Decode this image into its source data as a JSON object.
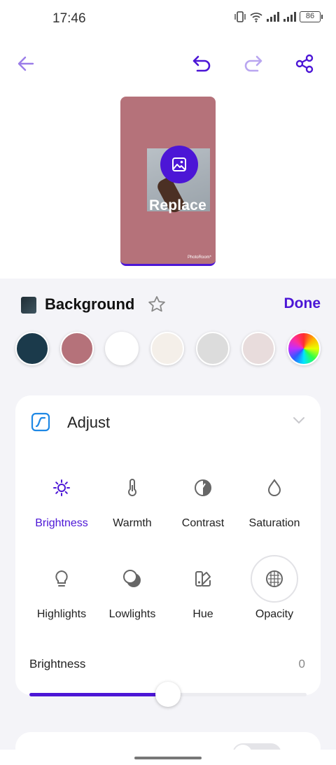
{
  "status_bar": {
    "time": "17:46",
    "battery": "86"
  },
  "toolbar": {
    "back_icon": "arrow-left-icon",
    "undo_icon": "undo-icon",
    "redo_icon": "redo-icon",
    "share_icon": "share-icon"
  },
  "preview": {
    "replace_label": "Replace",
    "watermark": "PhotoRoom*"
  },
  "background": {
    "title": "Background",
    "done_label": "Done",
    "swatches": [
      "#1b3a4b",
      "#b5727a",
      "#ffffff",
      "#f4efe9",
      "#dcdcdc",
      "#e8dcdc"
    ]
  },
  "adjust": {
    "title": "Adjust",
    "tools": [
      {
        "label": "Brightness",
        "icon": "sun-icon"
      },
      {
        "label": "Warmth",
        "icon": "thermometer-icon"
      },
      {
        "label": "Contrast",
        "icon": "contrast-icon"
      },
      {
        "label": "Saturation",
        "icon": "drop-icon"
      },
      {
        "label": "Highlights",
        "icon": "bulb-icon"
      },
      {
        "label": "Lowlights",
        "icon": "lowlights-icon"
      },
      {
        "label": "Hue",
        "icon": "palette-icon"
      },
      {
        "label": "Opacity",
        "icon": "opacity-icon"
      }
    ],
    "slider": {
      "label": "Brightness",
      "value": "0",
      "level": 0.5
    }
  },
  "colors": {
    "accent": "#4c16d6",
    "accent_light": "#b9a6f0"
  }
}
